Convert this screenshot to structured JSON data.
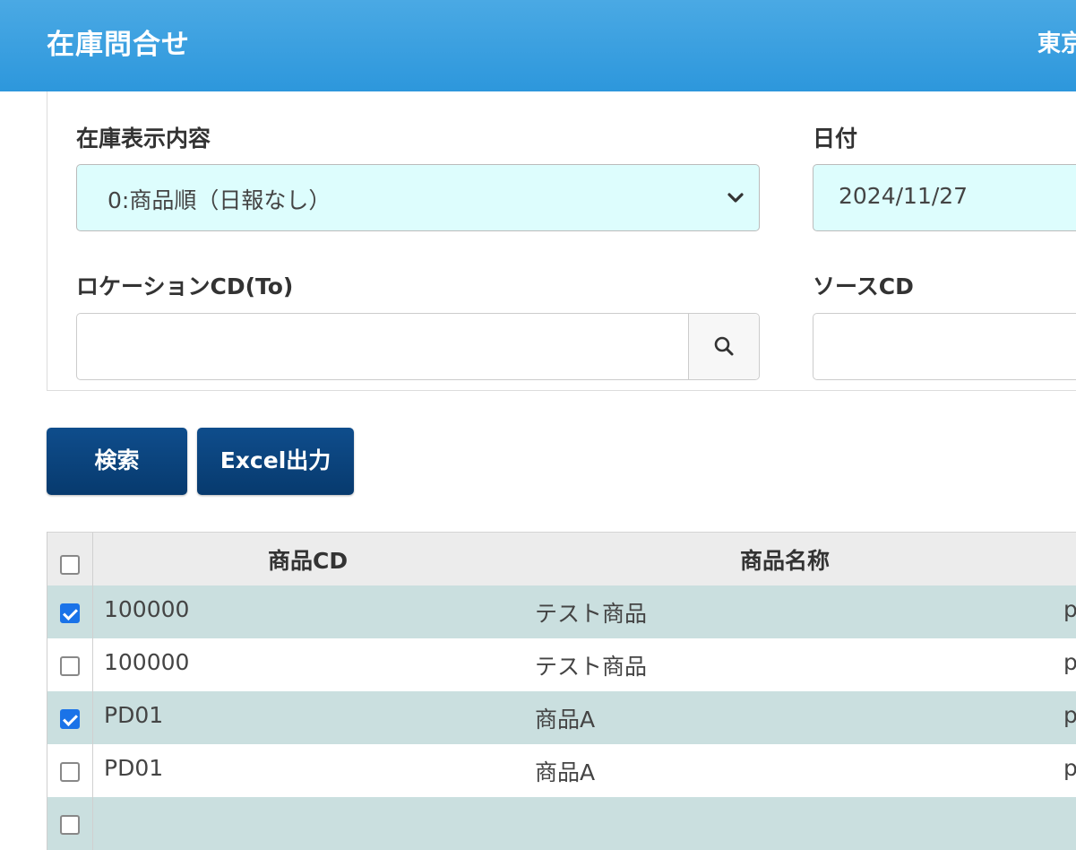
{
  "header": {
    "title": "在庫問合せ",
    "right_text": "東京"
  },
  "filters": {
    "stock_display": {
      "label": "在庫表示内容",
      "selected": "0:商品順（日報なし）"
    },
    "date": {
      "label": "日付",
      "value": "2024/11/27"
    },
    "location_to": {
      "label": "ロケーションCD(To)",
      "value": ""
    },
    "source_cd": {
      "label": "ソースCD",
      "value": ""
    }
  },
  "actions": {
    "search_label": "検索",
    "excel_label": "Excel出力"
  },
  "table": {
    "header_checked": false,
    "columns": [
      "商品CD",
      "商品名称"
    ],
    "rows": [
      {
        "checked": true,
        "code": "100000",
        "name": "テスト商品",
        "extra": "p"
      },
      {
        "checked": false,
        "code": "100000",
        "name": "テスト商品",
        "extra": "p"
      },
      {
        "checked": true,
        "code": "PD01",
        "name": "商品A",
        "extra": "p"
      },
      {
        "checked": false,
        "code": "PD01",
        "name": "商品A",
        "extra": "p"
      },
      {
        "checked": false,
        "code": "",
        "name": "",
        "extra": ""
      }
    ]
  },
  "colors": {
    "header_blue": "#2d97dc",
    "button_navy": "#0a4179",
    "select_bg": "#ddfdfd",
    "row_alt_bg": "#cadfdf",
    "checkbox_blue": "#1a73e8"
  }
}
